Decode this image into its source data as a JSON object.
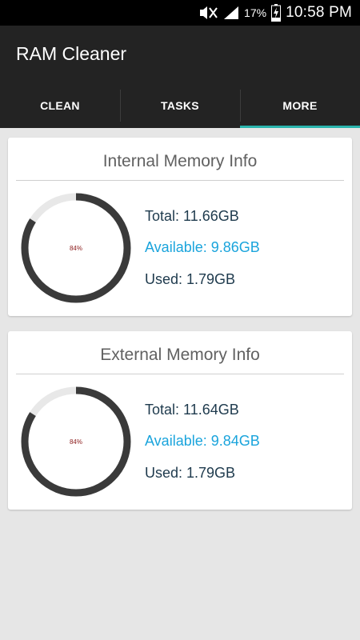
{
  "status_bar": {
    "battery_percent": "17%",
    "time": "10:58 PM",
    "icons": [
      "mute-icon",
      "signal-icon",
      "battery-charging-icon"
    ]
  },
  "app_bar": {
    "title": "RAM Cleaner"
  },
  "tabs": [
    {
      "label": "CLEAN",
      "active": false
    },
    {
      "label": "TASKS",
      "active": false
    },
    {
      "label": "MORE",
      "active": true
    }
  ],
  "colors": {
    "accent": "#2ab5ad",
    "available_text": "#1aa4dc",
    "ring_used": "#3a3a3a",
    "ring_free": "#e8e8e8",
    "ring_label": "#8b1a1a"
  },
  "internal": {
    "title": "Internal Memory Info",
    "percent_label": "84%",
    "percent_value": 84,
    "total": "Total: 11.66GB",
    "available": "Available: 9.86GB",
    "used": "Used: 1.79GB"
  },
  "external": {
    "title": "External Memory Info",
    "percent_label": "84%",
    "percent_value": 84,
    "total": "Total: 11.64GB",
    "available": "Available: 9.84GB",
    "used": "Used: 1.79GB"
  }
}
